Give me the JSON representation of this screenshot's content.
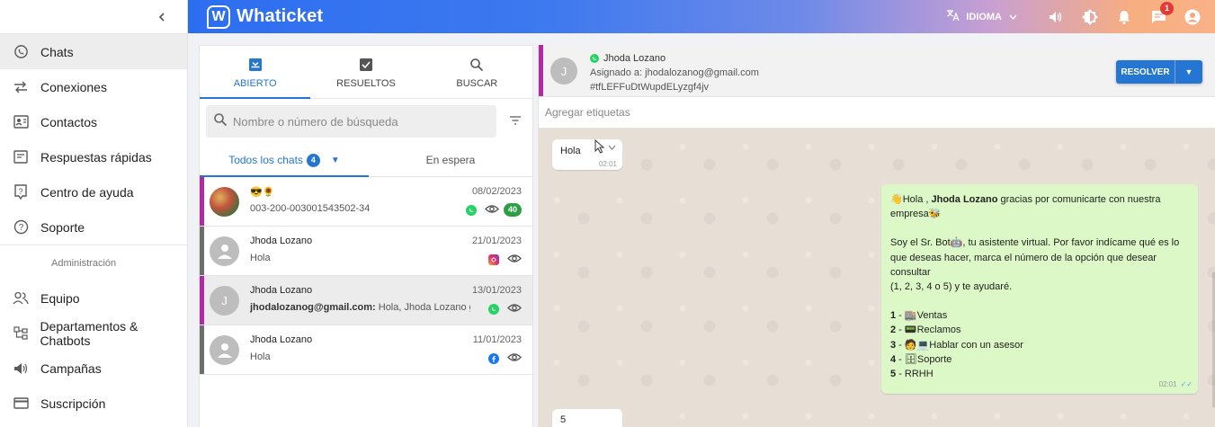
{
  "app": {
    "name": "Whaticket"
  },
  "sidebar": {
    "items": [
      {
        "label": "Chats",
        "icon": "whatsapp-icon"
      },
      {
        "label": "Conexiones",
        "icon": "swap-arrows-icon"
      },
      {
        "label": "Contactos",
        "icon": "contact-card-icon"
      },
      {
        "label": "Respuestas rápidas",
        "icon": "message-square-icon"
      },
      {
        "label": "Centro de ayuda",
        "icon": "help-box-icon"
      },
      {
        "label": "Soporte",
        "icon": "help-circle-icon"
      }
    ],
    "section_title": "Administración",
    "admin_items": [
      {
        "label": "Equipo",
        "icon": "people-icon"
      },
      {
        "label": "Departamentos & Chatbots",
        "icon": "flow-tree-icon"
      },
      {
        "label": "Campañas",
        "icon": "megaphone-icon"
      },
      {
        "label": "Suscripción",
        "icon": "credit-card-icon"
      }
    ]
  },
  "topbar": {
    "language_label": "IDIOMA",
    "notification_count": "1"
  },
  "tickets": {
    "tabs": [
      {
        "label": "ABIERTO",
        "icon": "inbox-icon"
      },
      {
        "label": "RESUELTOS",
        "icon": "checkbox-icon"
      },
      {
        "label": "BUSCAR",
        "icon": "search-icon"
      }
    ],
    "search_placeholder": "Nombre o número de búsqueda",
    "subtab_all": "Todos los chats",
    "subtab_all_count": "4",
    "subtab_waiting": "En espera",
    "list": [
      {
        "name": "😎🌻",
        "last_prefix": "",
        "last": "003-200-003001543502-34",
        "date": "08/02/2023",
        "channel": "whatsapp",
        "unread": "40",
        "bar_color": "#b02aa6",
        "avatar": "photo"
      },
      {
        "name": "Jhoda Lozano",
        "last_prefix": "",
        "last": "Hola",
        "date": "21/01/2023",
        "channel": "instagram",
        "unread": "",
        "bar_color": "#6d6d6d",
        "avatar": "person"
      },
      {
        "name": "Jhoda Lozano",
        "last_prefix": "jhodalozanog@gmail.com:",
        "last": " Hola, Jhoda Lozano gracias por comunicarte",
        "date": "13/01/2023",
        "channel": "whatsapp",
        "unread": "",
        "bar_color": "#b02aa6",
        "avatar": "J"
      },
      {
        "name": "Jhoda Lozano",
        "last_prefix": "",
        "last": "Hola",
        "date": "11/01/2023",
        "channel": "facebook",
        "unread": "",
        "bar_color": "#6d6d6d",
        "avatar": "person"
      }
    ]
  },
  "chat": {
    "contact_name": "Jhoda Lozano",
    "avatar_letter": "J",
    "assigned": "Asignado a: jhodalozanog@gmail.com",
    "ticket_id": "#tfLEFFuDtWupdELyzgf4jv",
    "resolve_label": "RESOLVER",
    "tags_placeholder": "Agregar etiquetas",
    "messages": {
      "in1_text": "Hola",
      "in1_time": "02:01",
      "out_greet_pre": "👋Hola , ",
      "out_greet_name": "Jhoda Lozano",
      "out_greet_post": " gracias por comunicarte con nuestra empresa🐝",
      "out_intro": "Soy el Sr. Bot🤖, tu asistente virtual. Por favor indícame qué es lo que deseas hacer, marca el número de la opción que desear consultar",
      "out_range": "(1, 2, 3, 4 o 5) y te ayudaré.",
      "options": [
        {
          "num": "1",
          "text": " - 🏬Ventas"
        },
        {
          "num": "2",
          "text": " - 📟Reclamos"
        },
        {
          "num": "3",
          "text": " - 🧑💻Hablar con un asesor"
        },
        {
          "num": "4",
          "text": " - 🗄Soporte"
        },
        {
          "num": "5",
          "text": " - RRHH"
        }
      ],
      "out_time": "02:01",
      "in2_text": "5"
    }
  },
  "colors": {
    "primary": "#2576d2",
    "whatsapp": "#25d366",
    "open_bar": "#b02aa6",
    "closed_bar": "#6d6d6d",
    "unread": "#2e9e44"
  }
}
